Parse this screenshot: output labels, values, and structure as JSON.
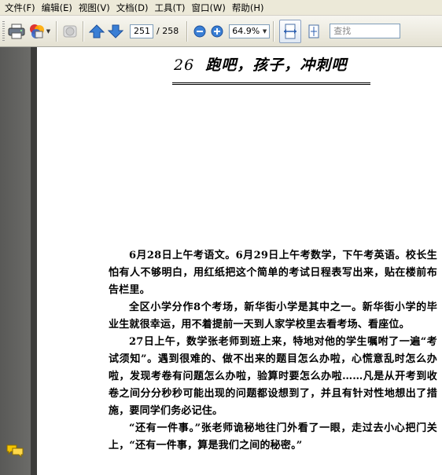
{
  "menu": {
    "items": [
      "文件(F)",
      "编辑(E)",
      "视图(V)",
      "文档(D)",
      "工具(T)",
      "窗口(W)",
      "帮助(H)"
    ]
  },
  "toolbar": {
    "current_page": "251",
    "total_pages": "/ 258",
    "zoom_level": "64.9%",
    "search_placeholder": "查找",
    "icons": [
      "print-icon",
      "share-icon",
      "hand-tool-icon",
      "previous-page-icon",
      "next-page-icon",
      "zoom-out-icon",
      "zoom-in-icon",
      "fit-width-icon",
      "fit-page-icon"
    ]
  },
  "sidebar": {
    "icons": [
      "comments-icon"
    ]
  },
  "document": {
    "chapter_number": "26",
    "chapter_title": "跑吧，孩子，冲刺吧",
    "paragraphs": [
      "6月28日上午考语文。6月29日上午考数学，下午考英语。校长生怕有人不够明白，用红纸把这个简单的考试日程表写出来，贴在楼前布告栏里。",
      "全区小学分作8个考场，新华街小学是其中之一。新华街小学的毕业生就很幸运，用不着提前一天到人家学校里去看考场、看座位。",
      "27日上午，数学张老师到班上来，特地对他的学生嘱咐了一遍“考试须知”。遇到很难的、做不出来的题目怎么办啦，心慌意乱时怎么办啦，发现考卷有问题怎么办啦，验算时要怎么办啦……凡是从开考到收卷之间分分秒秒可能出现的问题都设想到了，并且有针对性地想出了措施，要同学们务必记住。",
      "“还有一件事。”张老师诡秘地往门外看了一眼，走过去小心把门关上，“还有一件事，算是我们之间的秘密。”"
    ]
  }
}
